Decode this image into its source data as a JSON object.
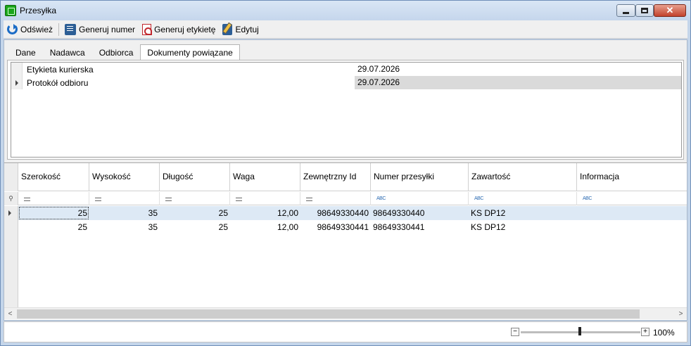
{
  "window": {
    "title": "Przesyłka"
  },
  "toolbar": {
    "refresh_label": "Odśwież",
    "generate_number_label": "Generuj numer",
    "generate_label_label": "Generuj etykietę",
    "edit_label": "Edytuj"
  },
  "tabs": [
    {
      "label": "Dane",
      "active": false
    },
    {
      "label": "Nadawca",
      "active": false
    },
    {
      "label": "Odbiorca",
      "active": false
    },
    {
      "label": "Dokumenty powiązane",
      "active": true
    }
  ],
  "documents": [
    {
      "name": "Etykieta kurierska",
      "date": "29.07.2026"
    },
    {
      "name": "Protokół odbioru",
      "date": "29.07.2026"
    }
  ],
  "grid": {
    "columns": [
      "Szerokość",
      "Wysokość",
      "Długość",
      "Waga",
      "Zewnętrzny Id",
      "Numer przesyłki",
      "Zawartość",
      "Informacja"
    ],
    "filter_types": [
      "eq",
      "eq",
      "eq",
      "eq",
      "eq",
      "abc",
      "abc",
      "abc"
    ],
    "filter_abc_glyph": "ABC",
    "rows": [
      [
        "25",
        "35",
        "25",
        "12,00",
        "98649330440",
        "98649330440",
        "KS DP12",
        ""
      ],
      [
        "25",
        "35",
        "25",
        "12,00",
        "98649330441",
        "98649330441",
        "KS DP12",
        ""
      ]
    ]
  },
  "statusbar": {
    "zoom_minus": "−",
    "zoom_plus": "+",
    "zoom_level": "100%"
  }
}
